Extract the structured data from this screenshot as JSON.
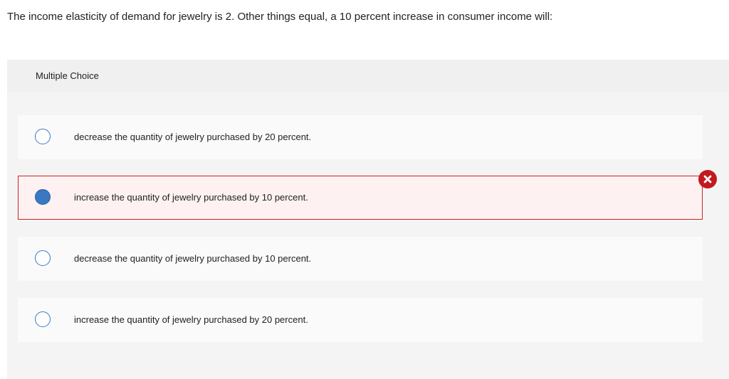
{
  "question": {
    "text": "The income elasticity of demand for jewelry is 2. Other things equal, a 10 percent increase in consumer income will:"
  },
  "answer_panel": {
    "type_label": "Multiple Choice",
    "options": [
      {
        "label": "decrease the quantity of jewelry purchased by 20 percent.",
        "selected": false
      },
      {
        "label": "increase the quantity of jewelry purchased by 10 percent.",
        "selected": true
      },
      {
        "label": "decrease the quantity of jewelry purchased by 10 percent.",
        "selected": false
      },
      {
        "label": "increase the quantity of jewelry purchased by 20 percent.",
        "selected": false
      }
    ],
    "result_icon": "incorrect-x-icon"
  },
  "colors": {
    "radio_accent": "#3a78c2",
    "error_red": "#c11a1f",
    "selected_bg": "#fdf1f1",
    "panel_bg": "#f4f4f4"
  }
}
